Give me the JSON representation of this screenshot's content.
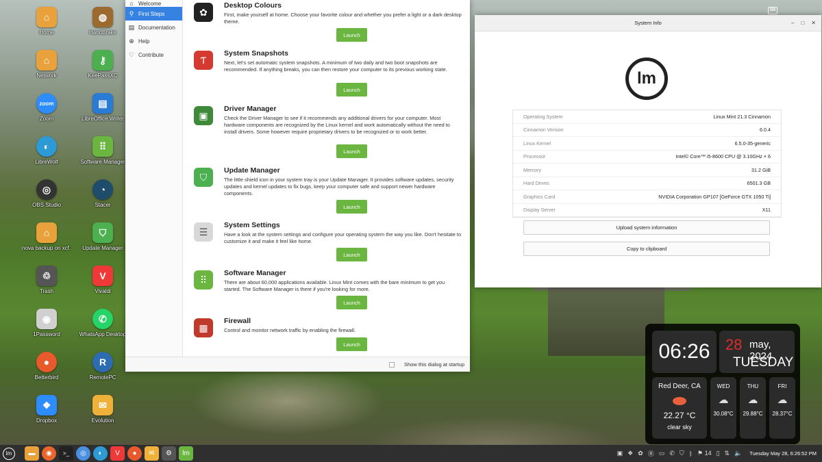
{
  "desktop": {
    "icons": [
      {
        "label": "Home",
        "icon": "home-folder-icon",
        "color": "#e9a23b"
      },
      {
        "label": "HandBrake",
        "icon": "handbrake-icon",
        "color": "#9c6a2f"
      },
      {
        "label": "Network",
        "icon": "network-folder-icon",
        "color": "#e9a23b"
      },
      {
        "label": "KeePassXC",
        "icon": "key-icon",
        "color": "#4caf50"
      },
      {
        "label": "Zoom",
        "icon": "zoom-icon",
        "color": "#2d8cff"
      },
      {
        "label": "LibreOffice Writer",
        "icon": "document-icon",
        "color": "#2a7bd4"
      },
      {
        "label": "LibreWolf",
        "icon": "librewolf-icon",
        "color": "#2d9ad6"
      },
      {
        "label": "Software Manager",
        "icon": "software-manager-icon",
        "color": "#6ab641"
      },
      {
        "label": "OBS Studio",
        "icon": "obs-icon",
        "color": "#333333"
      },
      {
        "label": "Stacer",
        "icon": "stacer-icon",
        "color": "#1e4d6b"
      },
      {
        "label": "nova backup on xcf..nas.local",
        "icon": "network-share-icon",
        "color": "#e9a23b"
      },
      {
        "label": "Update Manager",
        "icon": "shield-icon",
        "color": "#4caf50"
      },
      {
        "label": "Trash",
        "icon": "trash-icon",
        "color": "#555555"
      },
      {
        "label": "Vivaldi",
        "icon": "vivaldi-icon",
        "color": "#ef3939"
      },
      {
        "label": "1Password",
        "icon": "keyhole-icon",
        "color": "#d0d0d0"
      },
      {
        "label": "WhatsApp Desktop",
        "icon": "whatsapp-icon",
        "color": "#25d366"
      },
      {
        "label": "Betterbird",
        "icon": "betterbird-icon",
        "color": "#e85a2b"
      },
      {
        "label": "RemotePC",
        "icon": "remote-icon",
        "color": "#2d6cb0"
      },
      {
        "label": "Dropbox",
        "icon": "dropbox-icon",
        "color": "#2d8cff"
      },
      {
        "label": "Evolution",
        "icon": "mail-icon",
        "color": "#f0b13a"
      }
    ]
  },
  "welcome": {
    "sidebar": [
      {
        "label": "Welcome",
        "icon": "welcome-icon"
      },
      {
        "label": "First Steps",
        "icon": "first-steps-icon"
      },
      {
        "label": "Documentation",
        "icon": "book-icon"
      },
      {
        "label": "Help",
        "icon": "help-icon"
      },
      {
        "label": "Contribute",
        "icon": "heart-icon"
      }
    ],
    "features": [
      {
        "title": "Desktop Colours",
        "desc": "First, make yourself at home. Choose your favorite colour and whether you prefer a light or a dark desktop theme.",
        "button": "Launch",
        "icon": "color-palette-icon",
        "color": "#222222"
      },
      {
        "title": "System Snapshots",
        "desc": "Next, let's set automatic system snapshots. A minimum of two daily and two boot snapshots are recommended. If anything breaks, you can then restore your computer to its previous working state.",
        "button": "Launch",
        "icon": "timeshift-icon",
        "color": "#d43a2f"
      },
      {
        "title": "Driver Manager",
        "desc": "Check the Driver Manager to see if it recommends any additional drivers for your computer. Most hardware components are recognized by the Linux kernel and work automatically without the need to install drivers. Some however require proprietary drivers to be recognized or to work better.",
        "button": "Launch",
        "icon": "chip-icon",
        "color": "#3e8a3a"
      },
      {
        "title": "Update Manager",
        "desc": "The little shield icon in your system tray is your Update Manager. It provides software updates, security updates and kernel updates to fix bugs, keep your computer safe and support newer hardware components.",
        "button": "Launch",
        "icon": "shield-icon",
        "color": "#4caf50"
      },
      {
        "title": "System Settings",
        "desc": "Have a look at the system settings and configure your operating system the way you like. Don't hesitate to customize it and make it feel like home.",
        "button": "Launch",
        "icon": "toggle-settings-icon",
        "color": "#d8d8d8"
      },
      {
        "title": "Software Manager",
        "desc": "There are about 60,000 applications available. Linux Mint comes with the bare minimum to get you started. The Software Manager is there if you're looking for more.",
        "button": "Launch",
        "icon": "software-manager-icon",
        "color": "#6ab641"
      },
      {
        "title": "Firewall",
        "desc": "Control and monitor network traffic by enabling the firewall.",
        "button": "Launch",
        "icon": "firewall-brick-icon",
        "color": "#c0392b"
      }
    ],
    "footer": {
      "show_dialog": "Show this dialog at startup"
    }
  },
  "sysinfo": {
    "title": "System Info",
    "rows": [
      {
        "key": "Operating System",
        "value": "Linux Mint 21.3 Cinnamon"
      },
      {
        "key": "Cinnamon Version",
        "value": "6.0.4"
      },
      {
        "key": "Linux Kernel",
        "value": "6.5.0-35-generic"
      },
      {
        "key": "Processor",
        "value": "Intel© Core™ i5-8600 CPU @ 3.10GHz × 6"
      },
      {
        "key": "Memory",
        "value": "31.2 GiB"
      },
      {
        "key": "Hard Drives",
        "value": "6501.3 GB"
      },
      {
        "key": "Graphics Card",
        "value": "NVIDIA Corporation GP107 [GeForce GTX 1050 Ti]"
      },
      {
        "key": "Display Server",
        "value": "X11"
      }
    ],
    "upload_button": "Upload system information",
    "copy_button": "Copy to clipboard"
  },
  "widget": {
    "time": "06:26",
    "day": "28",
    "month_year": "may, 2024",
    "weekday": "TUESDAY",
    "city": "Red Deer, CA",
    "temp": "22.27 °C",
    "condition": "clear sky",
    "forecast": [
      {
        "day": "WED",
        "temp": "30.08°C"
      },
      {
        "day": "THU",
        "temp": "29.88°C"
      },
      {
        "day": "FRI",
        "temp": "28.37°C"
      }
    ]
  },
  "taskbar": {
    "tray_count": "14",
    "clock": "Tuesday May 28, 6:26:52 PM"
  }
}
